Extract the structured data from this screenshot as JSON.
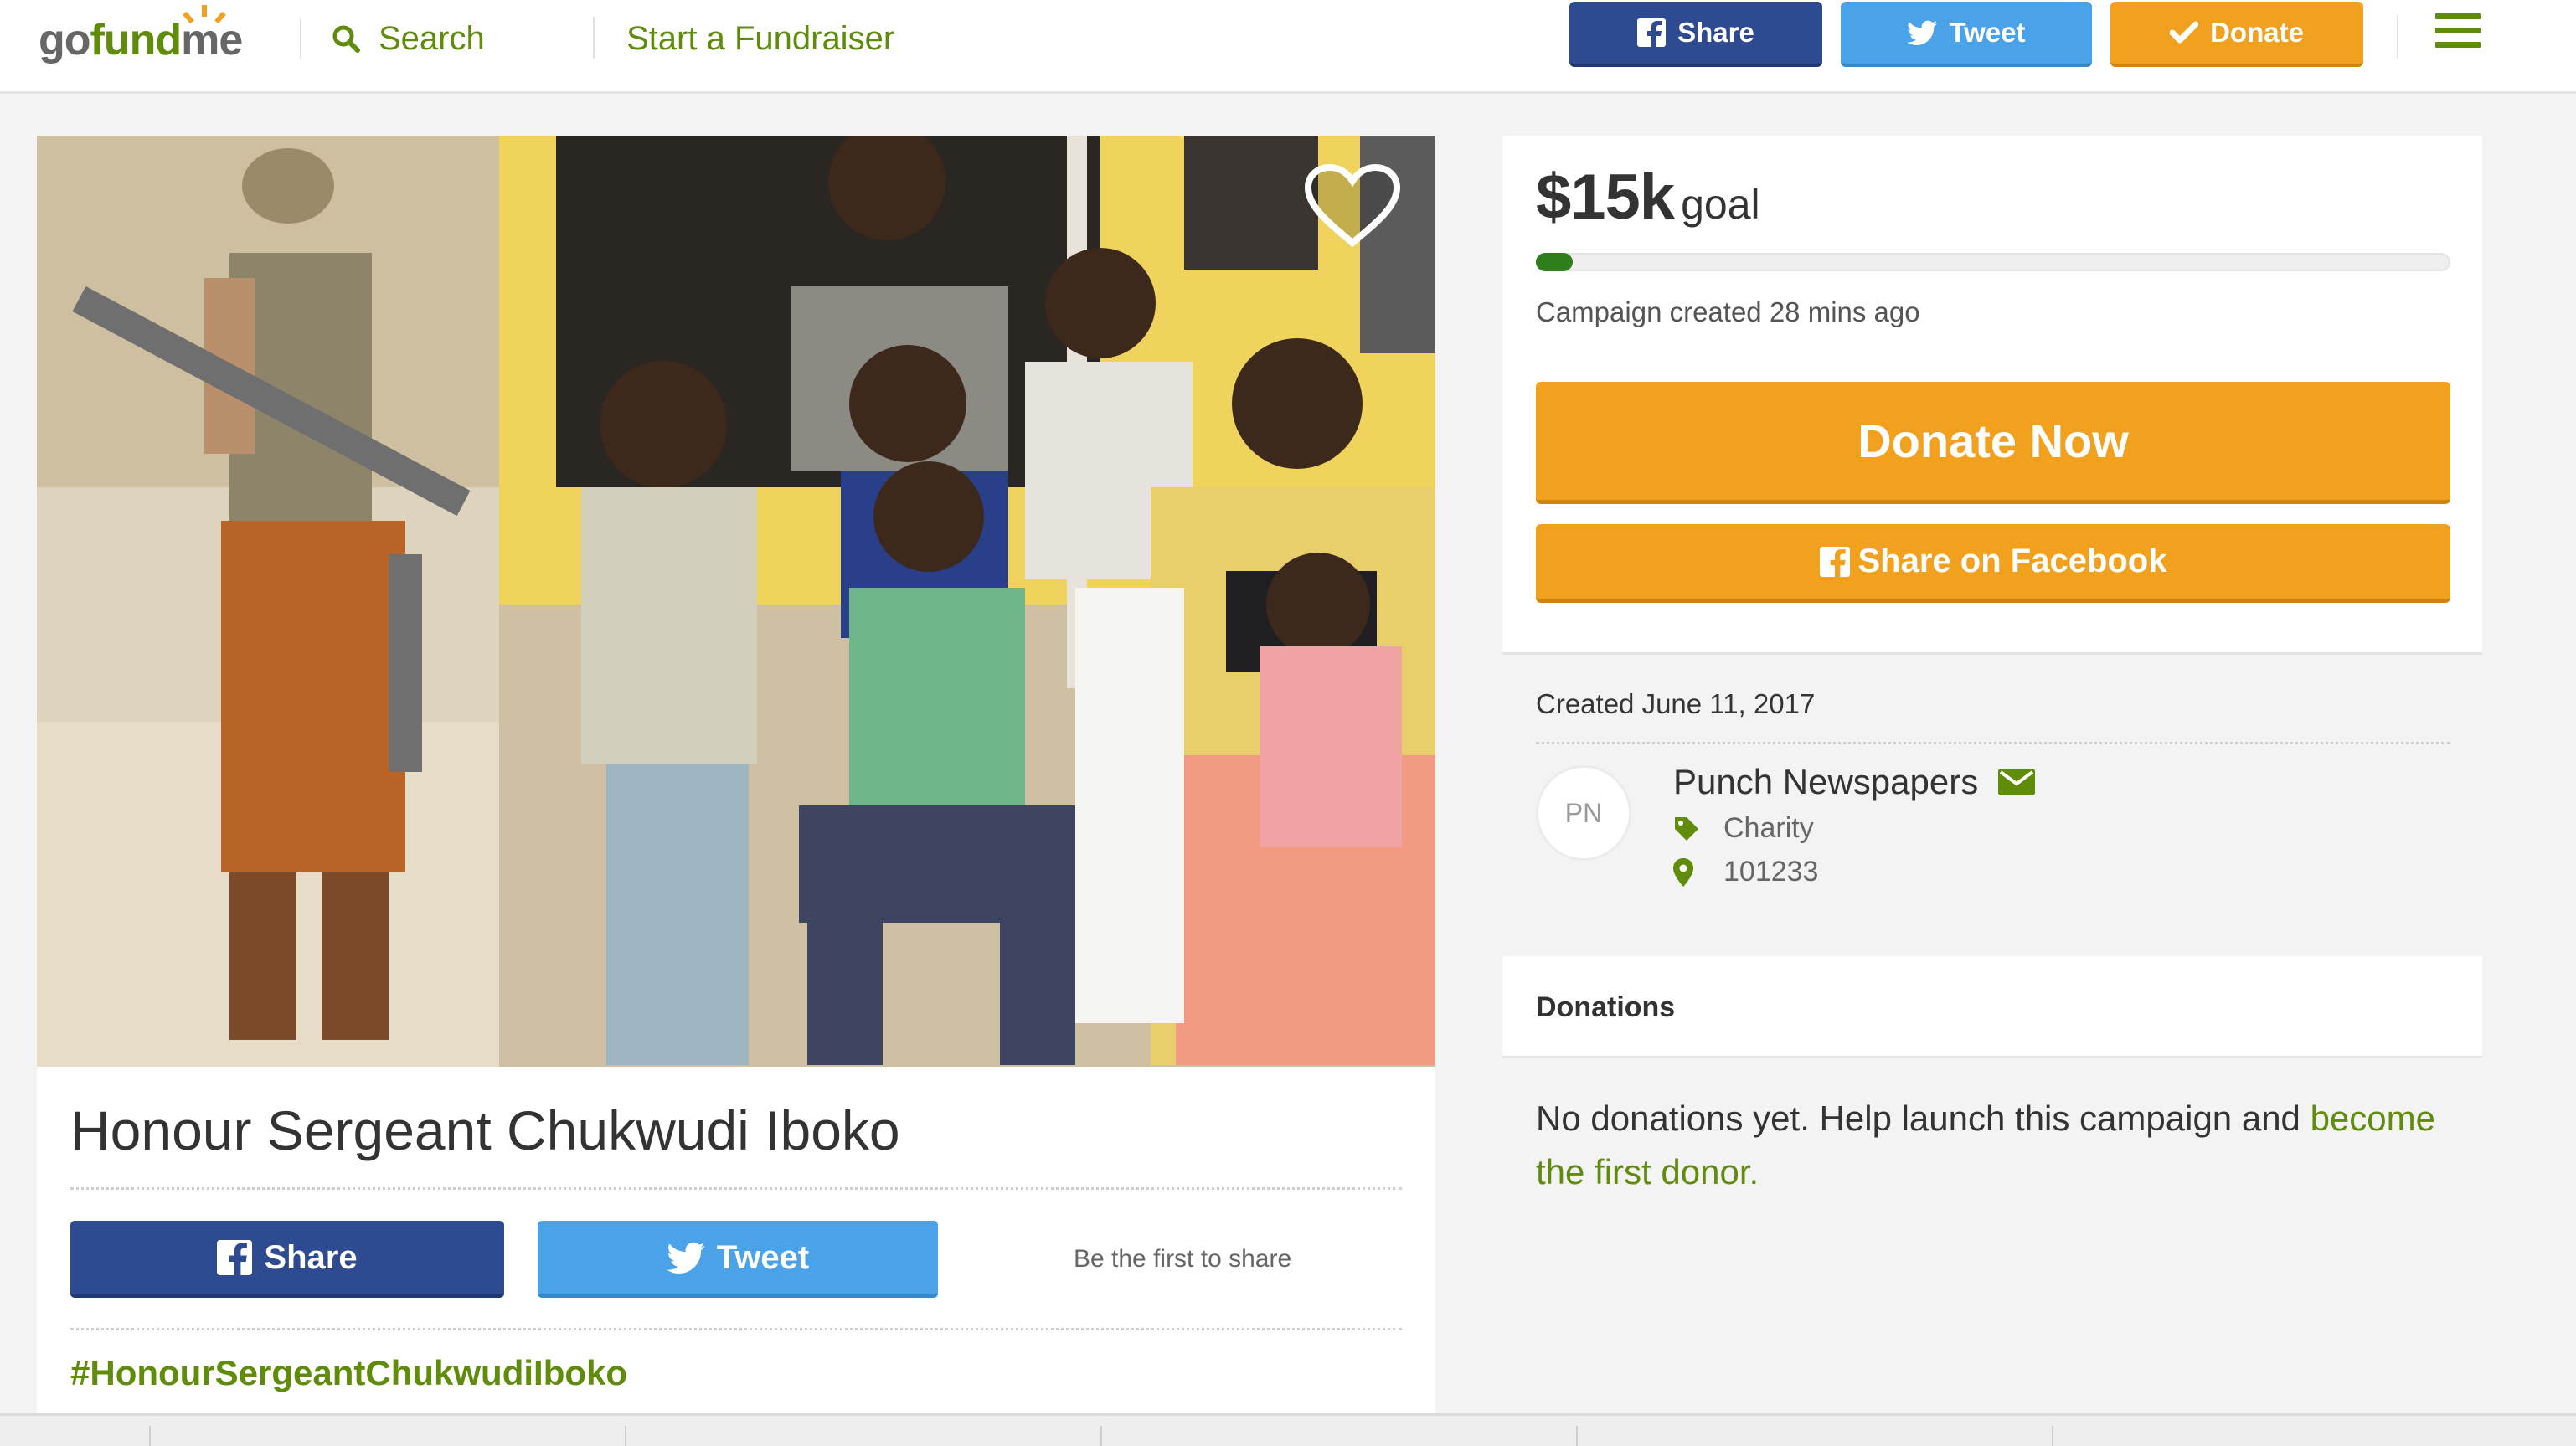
{
  "nav": {
    "logo": {
      "part1": "go",
      "part2": "fund",
      "part3": "me"
    },
    "search_label": "Search",
    "start_label": "Start a Fundraiser",
    "share_label": "Share",
    "tweet_label": "Tweet",
    "donate_label": "Donate"
  },
  "campaign": {
    "title": "Honour Sergeant Chukwudi Iboko",
    "share_label": "Share",
    "tweet_label": "Tweet",
    "first_share_text": "Be the first to share",
    "hashtag": "#HonourSergeantChukwudiIboko"
  },
  "goal": {
    "amount": "$15k",
    "label": "goal",
    "progress_fraction": 0.04,
    "created_ago": "Campaign created 28 mins ago",
    "donate_now_label": "Donate Now",
    "share_facebook_label": "Share on Facebook"
  },
  "organizer": {
    "created": "Created June 11, 2017",
    "initials": "PN",
    "name": "Punch Newspapers",
    "category": "Charity",
    "location": "101233"
  },
  "donations": {
    "header": "Donations",
    "empty_text": "No donations yet. Help launch this campaign and ",
    "empty_link": "become the first donor."
  },
  "colors": {
    "brand_green": "#5f8c0a",
    "facebook_blue": "#2e4a90",
    "twitter_blue": "#4aa3e8",
    "donate_orange": "#f2a11f",
    "progress_green": "#2f7d1b"
  },
  "icons": [
    "search-icon",
    "facebook-icon",
    "twitter-icon",
    "check-icon",
    "menu-icon",
    "heart-icon",
    "envelope-icon",
    "tag-icon",
    "map-marker-icon"
  ]
}
